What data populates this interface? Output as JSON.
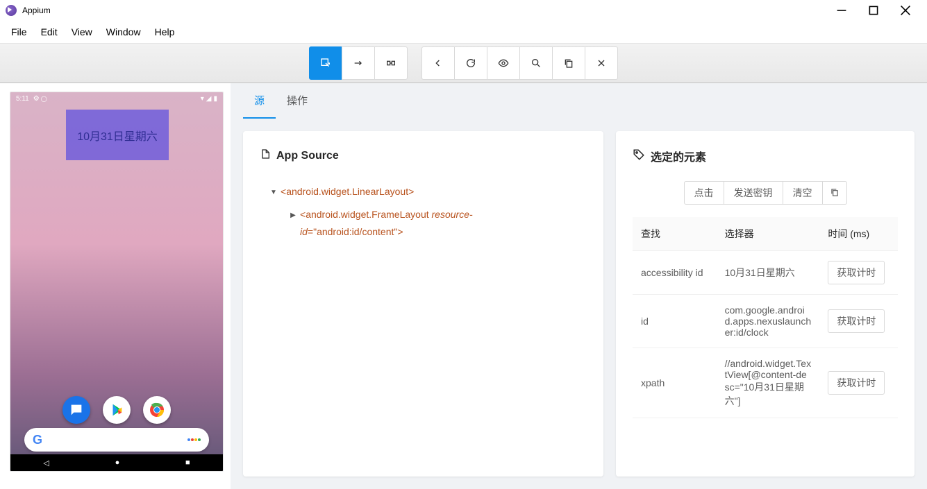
{
  "title": "Appium",
  "menu": {
    "file": "File",
    "edit": "Edit",
    "view": "View",
    "window": "Window",
    "help": "Help"
  },
  "toolbar_icons": {
    "select": "select-element-icon",
    "swipe": "swipe-icon",
    "tap": "tap-coordinates-icon",
    "back": "back-icon",
    "refresh": "refresh-icon",
    "eye": "recording-icon",
    "search": "search-icon",
    "copy": "copy-icon",
    "close": "close-icon"
  },
  "tabs": {
    "source": "源",
    "actions": "操作"
  },
  "source_panel": {
    "title": "App Source",
    "tree": {
      "root": "android.widget.LinearLayout",
      "child": "android.widget.FrameLayout",
      "child_attr_name": "resource-id",
      "child_attr_value": "\"android:id/content\""
    }
  },
  "selected_panel": {
    "title": "选定的元素",
    "actions": {
      "tap": "点击",
      "send_keys": "发送密钥",
      "clear": "清空"
    },
    "header": {
      "find": "查找",
      "selector": "选择器",
      "time": "时间 (ms)"
    },
    "timing_btn": "获取计时",
    "rows": [
      {
        "find": "accessibility id",
        "selector": "10月31日星期六"
      },
      {
        "find": "id",
        "selector": "com.google.android.apps.nexuslauncher:id/clock"
      },
      {
        "find": "xpath",
        "selector": "//android.widget.TextView[@content-desc=\"10月31日星期六\"]"
      }
    ]
  },
  "device": {
    "time": "5:11",
    "clock_widget": "10月31日星期六"
  }
}
